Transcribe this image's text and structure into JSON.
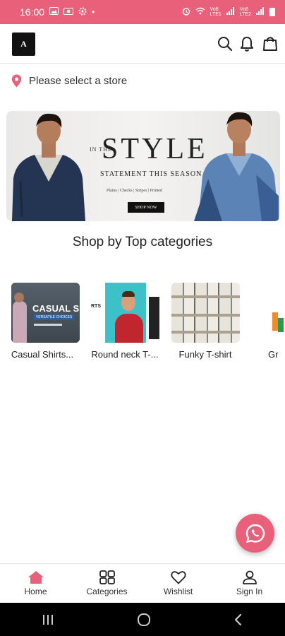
{
  "status_bar": {
    "time": "16:00",
    "dot": "•",
    "net1_top": "Vo8",
    "net1_bottom": "LTE1",
    "net2_top": "Vo8",
    "net2_bottom": "LTE2",
    "bg_color": "#e8607a"
  },
  "header": {
    "logo_text": "A",
    "icons": [
      "search-icon",
      "bell-icon",
      "shopping-bag-icon"
    ]
  },
  "store": {
    "label": "Please select a store",
    "icon": "location-pin-icon",
    "icon_color": "#e8607a"
  },
  "banner": {
    "kicker": "IN THE",
    "title": "STYLE",
    "subtitle": "STATEMENT THIS SEASON",
    "tags": "Plains | Checks | Stripes | Printed",
    "cta": "SHOP NOW"
  },
  "section_title": "Shop by Top categories",
  "categories": [
    {
      "label": "Casual Shirts...",
      "img_text": "CASUAL S",
      "img_sub": "VERSATILE CHOICES"
    },
    {
      "label": "Round neck T-...",
      "img_text": "RTS"
    },
    {
      "label": "Funky T-shirt"
    },
    {
      "label": "Gr"
    }
  ],
  "bottom_nav": {
    "items": [
      {
        "label": "Home",
        "icon": "home-icon",
        "active": true
      },
      {
        "label": "Categories",
        "icon": "grid-icon",
        "active": false
      },
      {
        "label": "Wishlist",
        "icon": "heart-icon",
        "active": false
      },
      {
        "label": "Sign In",
        "icon": "user-icon",
        "active": false
      }
    ],
    "accent": "#e8607a"
  },
  "fab": {
    "icon": "whatsapp-icon",
    "color": "#e8607a"
  },
  "system_nav": {
    "icons": [
      "recents-icon",
      "home-circle-icon",
      "back-icon"
    ]
  }
}
